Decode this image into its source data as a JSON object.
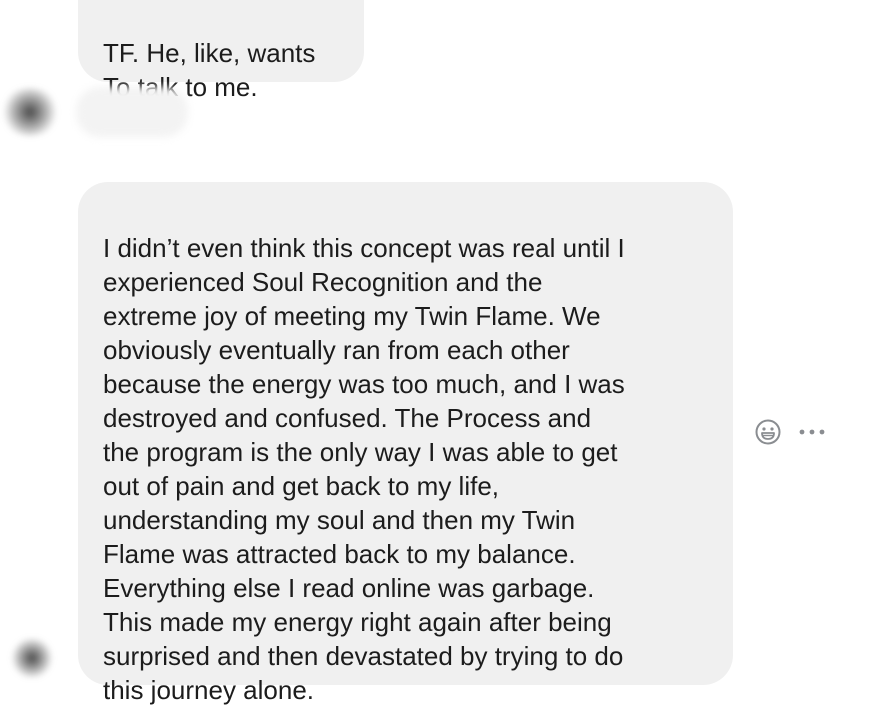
{
  "conversation": {
    "messages": [
      {
        "text": "TF. He, like, wants\nTo talk to me."
      },
      {
        "text": "I didn’t even think this concept was real until I\nexperienced Soul Recognition and the\nextreme joy of meeting my Twin Flame. We\nobviously eventually ran from each other\nbecause the energy was too much, and I was\ndestroyed and confused. The Process and\nthe program is the only way I was able to get\nout of pain and get back to my life,\nunderstanding my soul and then my Twin\nFlame was attracted back to my balance.\nEverything else I read online was garbage.\nThis made my energy right again after being\nsurprised and then devastated by trying to do\nthis journey alone."
      }
    ]
  },
  "message_actions": {
    "reaction_icon": "smiley-face-icon",
    "more_icon": "more-options-icon"
  },
  "colors": {
    "background": "#ffffff",
    "bubble": "#f0f0f0",
    "text": "#1c1c1c",
    "icon": "#8a8d91"
  }
}
